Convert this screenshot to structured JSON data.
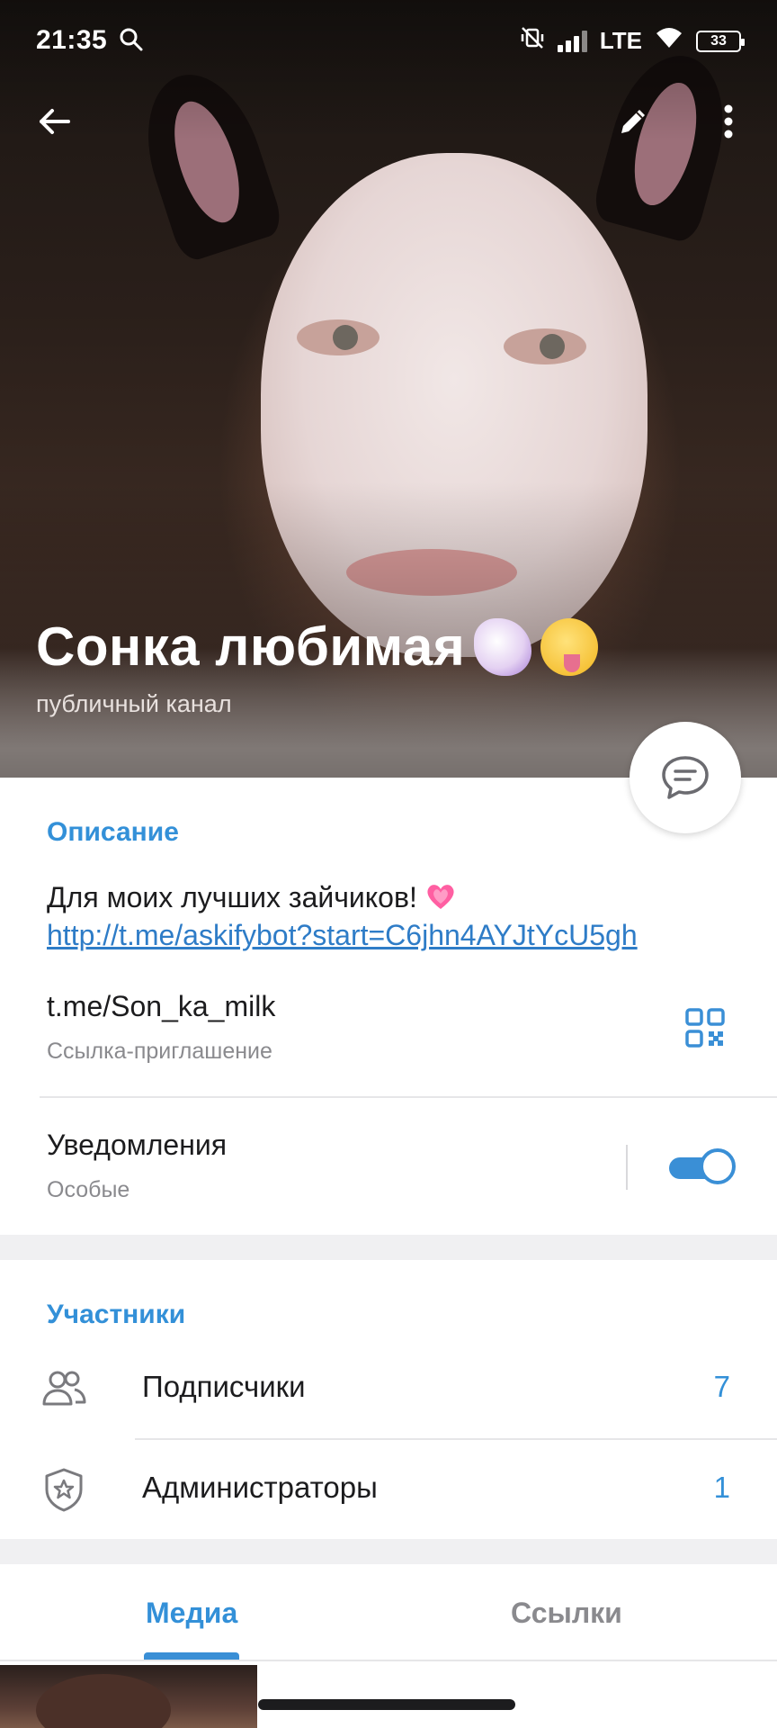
{
  "status_bar": {
    "time": "21:35",
    "network": "LTE",
    "battery": "33"
  },
  "header": {
    "title": "Сонка любимая",
    "title_emojis": [
      "unicorn-emoji",
      "zany-face-emoji"
    ],
    "subtitle": "публичный канал"
  },
  "info": {
    "section_title": "Описание",
    "description_text": "Для моих лучших зайчиков! ",
    "description_link": "http://t.me/askifybot?start=C6jhn4AYJtYcU5gh",
    "invite_link": "t.me/Son_ka_milk",
    "invite_link_label": "Ссылка-приглашение",
    "notifications_title": "Уведомления",
    "notifications_value": "Особые",
    "notifications_enabled": true
  },
  "members": {
    "section_title": "Участники",
    "rows": [
      {
        "label": "Подписчики",
        "count": "7",
        "icon": "people-icon"
      },
      {
        "label": "Администраторы",
        "count": "1",
        "icon": "shield-star-icon"
      }
    ]
  },
  "tabs": {
    "media": "Медиа",
    "links": "Ссылки"
  },
  "colors": {
    "accent": "#3390d8",
    "link": "#2e7cc7",
    "secondary_text": "#8a8a8e"
  }
}
